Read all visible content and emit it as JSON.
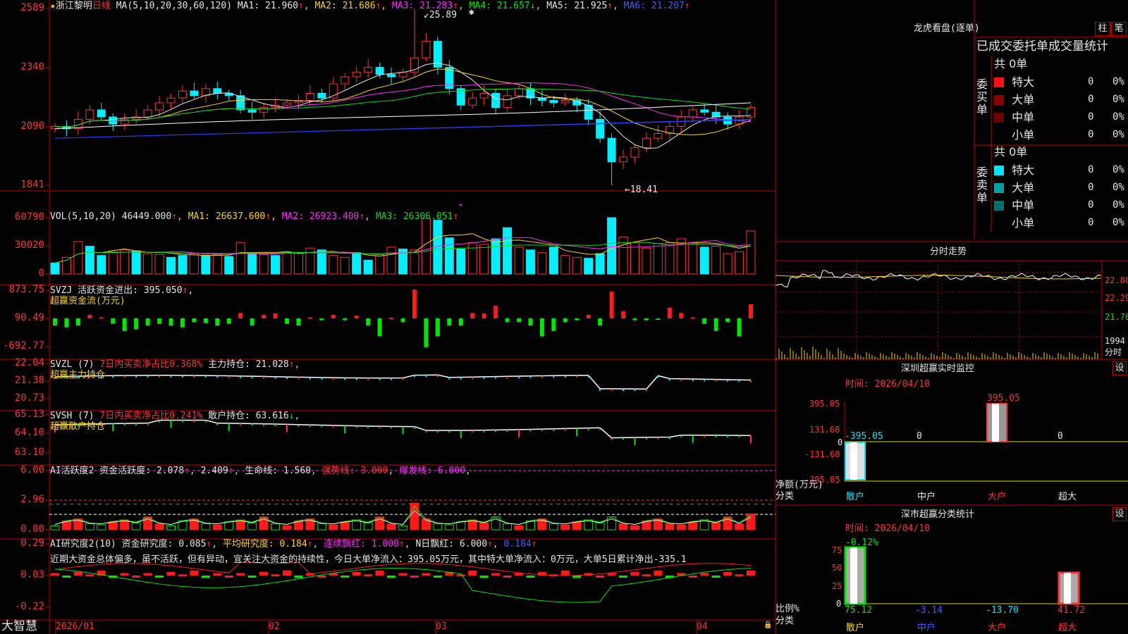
{
  "stock": {
    "name": "浙江黎明",
    "star": "★",
    "period": "日线"
  },
  "main": {
    "ma_params": "MA(5,10,20,30,60,120)",
    "ma1": "MA1: 21.960",
    "ma2": "MA2: 21.686",
    "ma3": "MA3: 21.283",
    "ma4": "MA4: 21.657",
    "ma5": "MA5: 21.925",
    "ma6": "MA6: 21.207",
    "yticks": [
      "2589",
      "2340",
      "2090",
      "1841"
    ],
    "high_label": "25.89",
    "low_label": "←18.41",
    "colors": {
      "up": "#ff3232",
      "down": "#00f0ff"
    }
  },
  "vol": {
    "head": "VOL(5,10,20)",
    "value": "46449.000",
    "ma1": "MA1: 26637.600",
    "ma2": "MA2: 26923.400",
    "ma3": "MA3: 26306.051",
    "yticks": [
      "60790",
      "30020",
      "0"
    ]
  },
  "svzj": {
    "head": "SVZJ  活跃资金进出: 395.050",
    "sub": "超赢资金流(万元)",
    "yticks": [
      "873.75",
      "90.49",
      "-692.77"
    ]
  },
  "svzl": {
    "head": "SVZL (7) ",
    "pct": "7日内买卖净占比0.368%",
    "hold": "主力持仓: 21.028",
    "sub": "超赢主力持仓",
    "yticks": [
      "22.04",
      "21.38",
      "20.73"
    ]
  },
  "svsh": {
    "head": "SVSH (7) ",
    "pct": "7日内买卖净占比0.241%",
    "hold": "散户持仓: 63.616",
    "sub": "超赢散户持仓",
    "yticks": [
      "65.13",
      "64.10",
      "63.10"
    ]
  },
  "ai1": {
    "head": "AI活跃度2 资金活跃度: 2.078",
    "v2": "2.409",
    "life": "生命线: 1.560",
    "strong": "强势线: 3.000",
    "burst": "爆发线: 6.000",
    "yticks": [
      "6.00",
      "2.96",
      "0.00"
    ]
  },
  "ai2": {
    "head": "AI研究度2(10) 资金研究度: 0.085",
    "avg": "平均研究度: 0.184",
    "cont": "连续飘红: 1.000",
    "nday": "N日飘红: 6.000",
    "last": "0.184",
    "yticks": [
      "0.29",
      "0.03",
      "-0.22"
    ],
    "comment": "近期大资金总体偏多，虽不活跃，但有异动，宜关注大资金的持续性，今日大单净流入：395.05万元，其中特大单净流入：0万元，大单5日累计净出-335.1"
  },
  "xaxis": [
    "2026/01",
    "02",
    "03",
    "04"
  ],
  "brand": "大智慧",
  "dragon": {
    "title": "龙虎看盘(逐单)",
    "btn1": "柱",
    "btn2": "笔",
    "tabs": "已成交委托单成交量统计",
    "buy": {
      "side": "委买单",
      "total": "共 0单",
      "rows": [
        {
          "name": "特大",
          "n": "0",
          "p": "0%",
          "c": "#ff1010"
        },
        {
          "name": "大单",
          "n": "0",
          "p": "0%",
          "c": "#8b0000"
        },
        {
          "name": "中单",
          "n": "0",
          "p": "0%",
          "c": "#6a0000"
        },
        {
          "name": "小单",
          "n": "0",
          "p": "0%",
          "c": "#000"
        }
      ]
    },
    "sell": {
      "side": "委卖单",
      "total": "共 0单",
      "rows": [
        {
          "name": "特大",
          "n": "0",
          "p": "0%",
          "c": "#00e5ff"
        },
        {
          "name": "大单",
          "n": "0",
          "p": "0%",
          "c": "#00a0a0"
        },
        {
          "name": "中单",
          "n": "0",
          "p": "0%",
          "c": "#007070"
        },
        {
          "name": "小单",
          "n": "0",
          "p": "0%",
          "c": "#000"
        }
      ]
    }
  },
  "intraday": {
    "title": "分时走势",
    "prices": [
      "22.80",
      "22.29",
      "21.78"
    ],
    "vol": "1994",
    "vol_unit": "分时"
  },
  "monitor": {
    "title": "深圳超赢实时监控",
    "btn": "设",
    "date": "时间: 2026/04/10",
    "yticks": [
      "395.05",
      "131.68",
      "0",
      "-131.68",
      "-395.05"
    ],
    "labels": [
      "-395.05",
      "0",
      "395.05",
      "0"
    ],
    "ylabel": "净额(万元)",
    "xlabel": "分类",
    "cats": [
      "散户",
      "中户",
      "大户",
      "超大"
    ]
  },
  "classify": {
    "title": "深市超赢分类统计",
    "btn": "设",
    "date": "时间: 2026/04/10",
    "top": "-0.12%",
    "yticks": [
      "75",
      "50",
      "25",
      "0"
    ],
    "vals": [
      "75.12",
      "-3.14",
      "-13.70",
      "41.72"
    ],
    "ylabel": "比例%",
    "xlabel": "分类",
    "cats": [
      "散户",
      "中户",
      "大户",
      "超大"
    ]
  }
}
